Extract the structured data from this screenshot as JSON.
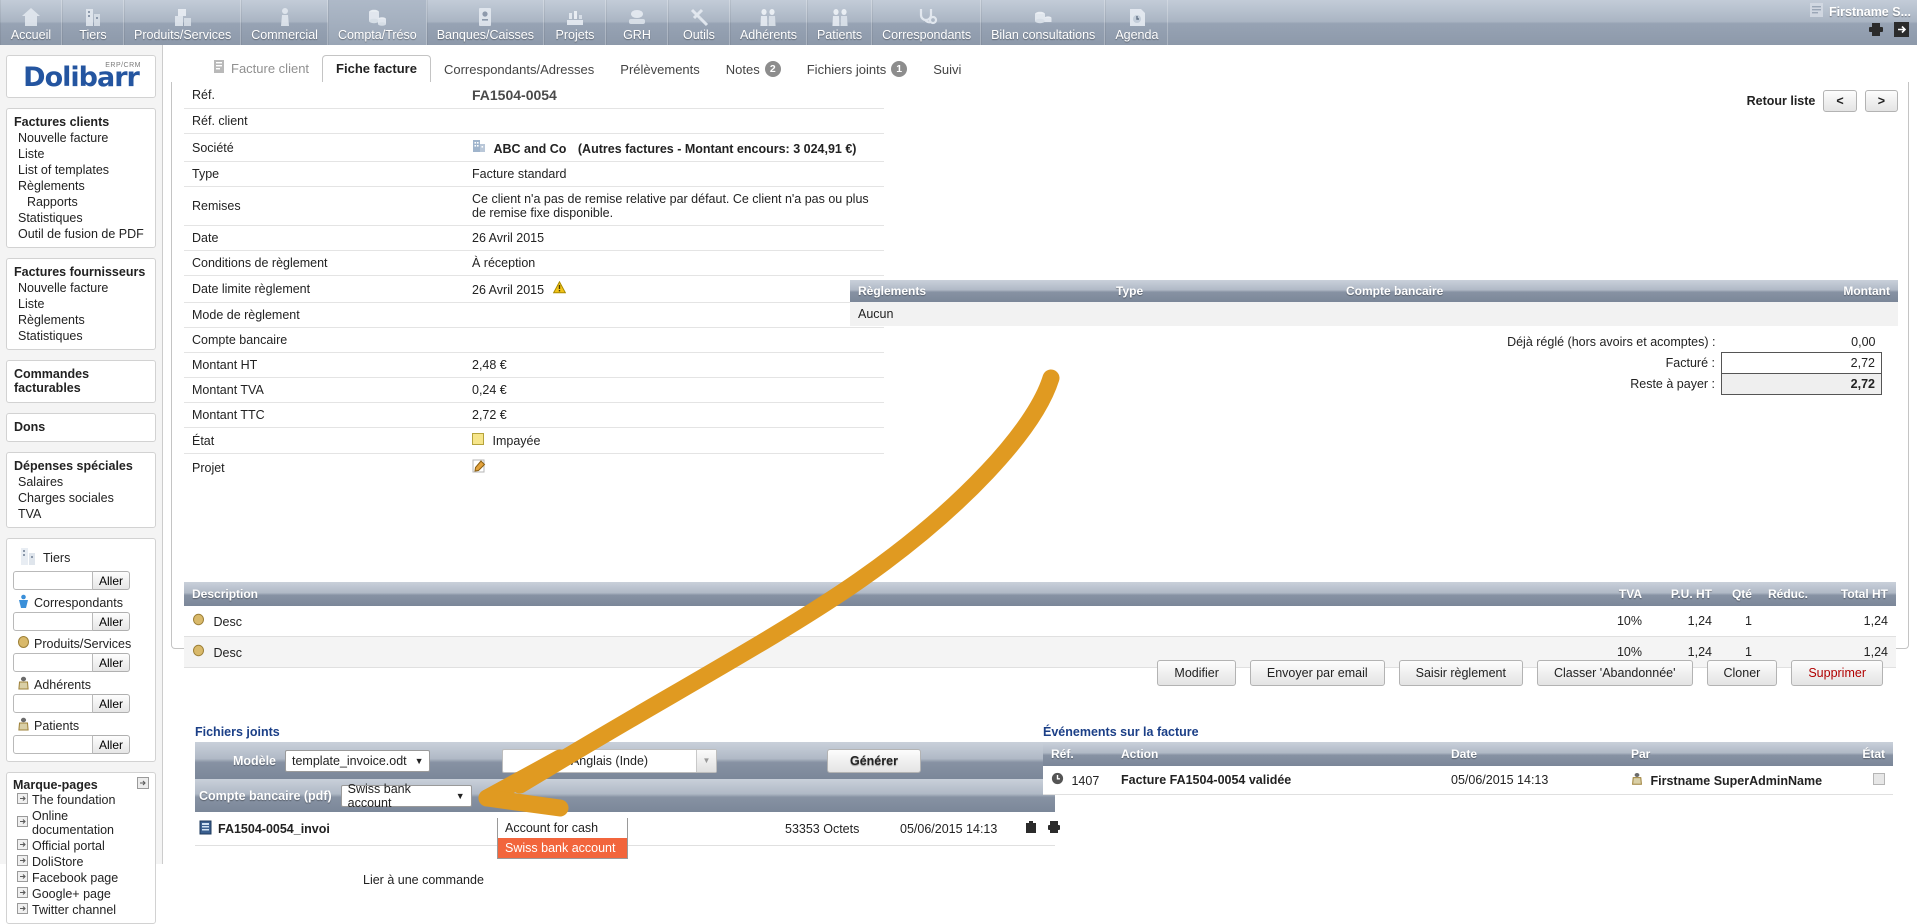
{
  "topmenu": {
    "items": [
      {
        "label": "Accueil",
        "icon": "home-icon",
        "selected": false
      },
      {
        "label": "Tiers",
        "icon": "company-icon",
        "selected": false
      },
      {
        "label": "Produits/Services",
        "icon": "box-icon",
        "selected": false
      },
      {
        "label": "Commercial",
        "icon": "handshake-icon",
        "selected": false
      },
      {
        "label": "Compta/Tréso",
        "icon": "coins-icon",
        "selected": true
      },
      {
        "label": "Banques/Caisses",
        "icon": "bank-icon",
        "selected": false
      },
      {
        "label": "Projets",
        "icon": "project-icon",
        "selected": false
      },
      {
        "label": "GRH",
        "icon": "hr-icon",
        "selected": false
      },
      {
        "label": "Outils",
        "icon": "tools-icon",
        "selected": false
      },
      {
        "label": "Adhérents",
        "icon": "members-icon",
        "selected": false
      },
      {
        "label": "Patients",
        "icon": "patients-icon",
        "selected": false
      },
      {
        "label": "Correspondants",
        "icon": "stethoscope-icon",
        "selected": false
      },
      {
        "label": "Bilan consultations",
        "icon": "coins2-icon",
        "selected": false
      },
      {
        "label": "Agenda",
        "icon": "agenda-icon",
        "selected": false
      }
    ],
    "user": "Firstname S...",
    "print_icon": "printer-icon",
    "logout_icon": "logout-icon"
  },
  "sidebar": {
    "logo": {
      "name": "Dolibarr",
      "sup": "ERP/CRM"
    },
    "groups": [
      {
        "title": "Factures clients",
        "links": [
          {
            "label": "Nouvelle facture",
            "sub": false
          },
          {
            "label": "Liste",
            "sub": false
          },
          {
            "label": "List of templates",
            "sub": false
          },
          {
            "label": "Règlements",
            "sub": false
          },
          {
            "label": "Rapports",
            "sub": true
          },
          {
            "label": "Statistiques",
            "sub": false
          },
          {
            "label": "Outil de fusion de PDF",
            "sub": false
          }
        ]
      },
      {
        "title": "Factures fournisseurs",
        "links": [
          {
            "label": "Nouvelle facture",
            "sub": false
          },
          {
            "label": "Liste",
            "sub": false
          },
          {
            "label": "Règlements",
            "sub": false
          },
          {
            "label": "Statistiques",
            "sub": false
          }
        ]
      },
      {
        "title": "Commandes facturables",
        "links": []
      },
      {
        "title": "Dons",
        "links": []
      },
      {
        "title": "Dépenses spéciales",
        "links": [
          {
            "label": "Salaires",
            "sub": false
          },
          {
            "label": "Charges sociales",
            "sub": false
          },
          {
            "label": "TVA",
            "sub": false
          }
        ]
      }
    ],
    "quicksearch": [
      {
        "label": "Tiers",
        "icon": "company-icon",
        "value": "",
        "button": "Aller"
      },
      {
        "label": "Correspondants",
        "icon": "contact-icon",
        "value": "",
        "button": "Aller"
      },
      {
        "label": "Produits/Services",
        "icon": "product-icon",
        "value": "",
        "button": "Aller"
      },
      {
        "label": "Adhérents",
        "icon": "member-icon",
        "value": "",
        "button": "Aller"
      },
      {
        "label": "Patients",
        "icon": "patient-icon",
        "value": "",
        "button": "Aller"
      }
    ],
    "bookmarks": {
      "title": "Marque-pages",
      "edit_icon": "edit-bookmarks-icon",
      "items": [
        "The foundation",
        "Online documentation",
        "Official portal",
        "DoliStore",
        "Facebook page",
        "Google+ page",
        "Twitter channel"
      ]
    }
  },
  "tabs": [
    {
      "label": "Facture client",
      "icon": "invoice-icon",
      "active": false,
      "dim": true,
      "badge": null
    },
    {
      "label": "Fiche facture",
      "icon": null,
      "active": true,
      "dim": false,
      "badge": null
    },
    {
      "label": "Correspondants/Adresses",
      "icon": null,
      "active": false,
      "dim": false,
      "badge": null
    },
    {
      "label": "Prélèvements",
      "icon": null,
      "active": false,
      "dim": false,
      "badge": null
    },
    {
      "label": "Notes",
      "icon": null,
      "active": false,
      "dim": false,
      "badge": "2"
    },
    {
      "label": "Fichiers joints",
      "icon": null,
      "active": false,
      "dim": false,
      "badge": "1"
    },
    {
      "label": "Suivi",
      "icon": null,
      "active": false,
      "dim": false,
      "badge": null
    }
  ],
  "card": {
    "nav": {
      "back_label": "Retour liste",
      "prev": "<",
      "next": ">"
    },
    "rows": [
      {
        "label": "Réf.",
        "value": "FA1504-0054",
        "style": "ref"
      },
      {
        "label": "Réf. client",
        "value": "",
        "style": "plain"
      },
      {
        "label": "Société",
        "value": "ABC and Co",
        "extra": "(Autres factures - Montant encours: 3 024,91 €)",
        "style": "company"
      },
      {
        "label": "Type",
        "value": "Facture standard",
        "style": "plain"
      },
      {
        "label": "Remises",
        "value": "Ce client n'a pas de remise relative par défaut. Ce client n'a pas ou plus de remise fixe disponible.",
        "style": "plain"
      },
      {
        "label": "Date",
        "value": "26 Avril 2015",
        "style": "plain"
      },
      {
        "label": "Conditions de règlement",
        "value": "À réception",
        "style": "plain"
      },
      {
        "label": "Date limite règlement",
        "value": "26 Avril 2015",
        "style": "warn"
      },
      {
        "label": "Mode de règlement",
        "value": "",
        "style": "plain"
      },
      {
        "label": "Compte bancaire",
        "value": "",
        "style": "plain"
      },
      {
        "label": "Montant HT",
        "value": "2,48 €",
        "style": "plain"
      },
      {
        "label": "Montant TVA",
        "value": "0,24 €",
        "style": "plain"
      },
      {
        "label": "Montant TTC",
        "value": "2,72 €",
        "style": "plain"
      },
      {
        "label": "État",
        "value": "Impayée",
        "style": "status"
      },
      {
        "label": "Projet",
        "value": "",
        "style": "project"
      }
    ],
    "payments": {
      "headers": [
        "Règlements",
        "Type",
        "Compte bancaire",
        "Montant"
      ],
      "empty_label": "Aucun",
      "totals": [
        {
          "label": "Déjà réglé (hors avoirs et acomptes) :",
          "value": "0,00",
          "box": "none"
        },
        {
          "label": "Facturé :",
          "value": "2,72",
          "box": "plain"
        },
        {
          "label": "Reste à payer :",
          "value": "2,72",
          "box": "shaded"
        }
      ]
    },
    "lines": {
      "headers": [
        "Description",
        "TVA",
        "P.U. HT",
        "Qté",
        "Réduc.",
        "Total HT"
      ],
      "rows": [
        {
          "desc": "Desc",
          "tva": "10%",
          "pu": "1,24",
          "qty": "1",
          "reduc": "",
          "total": "1,24"
        },
        {
          "desc": "Desc",
          "tva": "10%",
          "pu": "1,24",
          "qty": "1",
          "reduc": "",
          "total": "1,24"
        }
      ]
    }
  },
  "actions": [
    {
      "label": "Modifier",
      "danger": false
    },
    {
      "label": "Envoyer par email",
      "danger": false
    },
    {
      "label": "Saisir règlement",
      "danger": false
    },
    {
      "label": "Classer 'Abandonnée'",
      "danger": false
    },
    {
      "label": "Cloner",
      "danger": false
    },
    {
      "label": "Supprimer",
      "danger": true
    }
  ],
  "attachments": {
    "title": "Fichiers joints",
    "model_label": "Modèle",
    "model_value": "template_invoice.odt",
    "language_value": "Anglais (Inde)",
    "generate_label": "Générer",
    "bank_label": "Compte bancaire (pdf)",
    "bank_value": "Swiss bank account",
    "dropdown_options": [
      {
        "label": "Account for cash",
        "highlighted": false
      },
      {
        "label": "Swiss bank account",
        "highlighted": true
      }
    ],
    "file": {
      "name": "FA1504-0054_invoi",
      "size": "53353 Octets",
      "date": "05/06/2015 14:13",
      "delete_icon": "trash-icon",
      "print_icon": "printer-icon"
    },
    "link_order": "Lier à une commande"
  },
  "events": {
    "title": "Événements sur la facture",
    "headers": [
      "Réf.",
      "Action",
      "Date",
      "Par",
      "État"
    ],
    "rows": [
      {
        "ref": "1407",
        "action": "Facture FA1504-0054 validée",
        "date": "05/06/2015 14:13",
        "by": "Firstname SuperAdminName",
        "state": ""
      }
    ]
  },
  "colors": {
    "accent": "#1b3f87",
    "highlight": "#f2653c",
    "annotation": "#e09a21",
    "danger": "#b00000"
  }
}
